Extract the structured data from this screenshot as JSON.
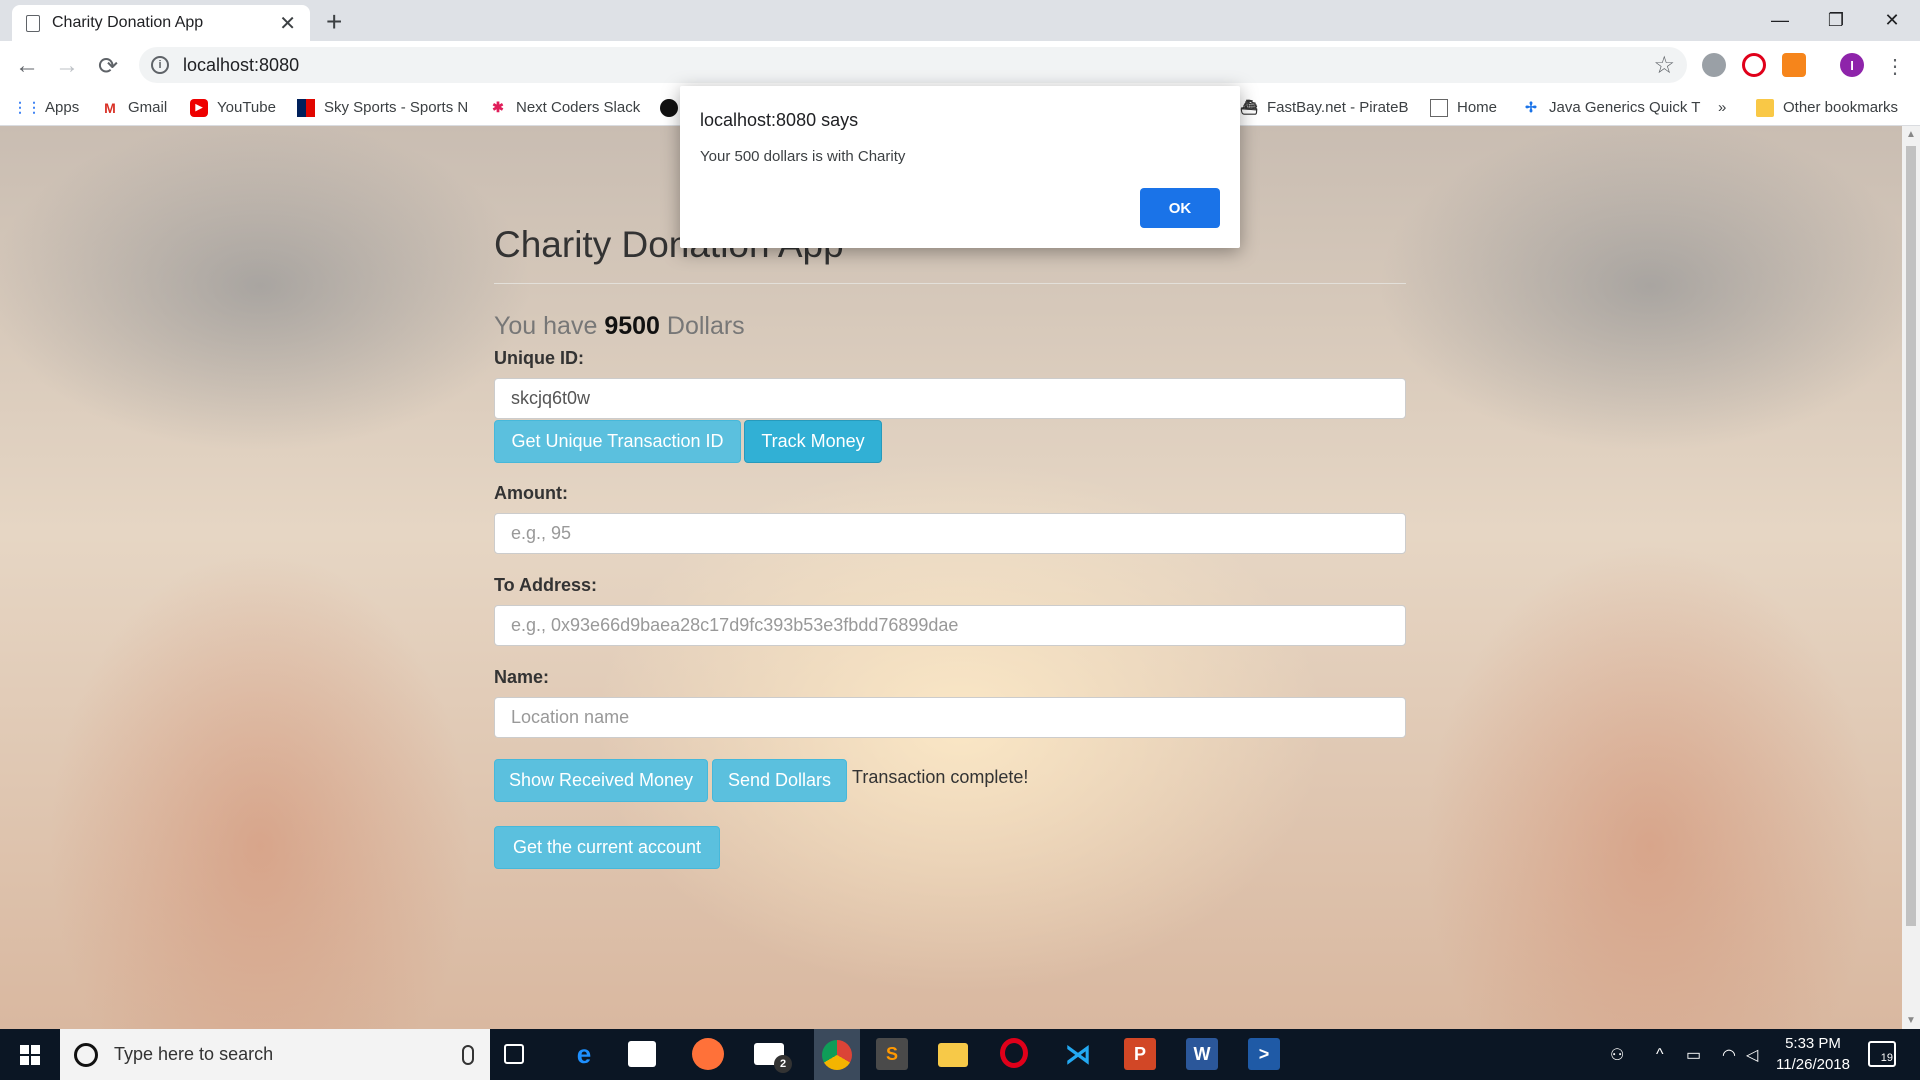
{
  "browser": {
    "tab_title": "Charity Donation App",
    "url": "localhost:8080",
    "profile_initial": "I",
    "bookmarks": [
      {
        "label": "Apps",
        "icon": "apps-grid-icon"
      },
      {
        "label": "Gmail",
        "icon": "gmail-icon"
      },
      {
        "label": "YouTube",
        "icon": "youtube-icon"
      },
      {
        "label": "Sky Sports - Sports N",
        "icon": "sky-sports-icon"
      },
      {
        "label": "Next Coders Slack",
        "icon": "slack-icon"
      },
      {
        "label": "",
        "icon": "github-icon"
      },
      {
        "label": "FastBay.net - PirateB",
        "icon": "ship-icon"
      },
      {
        "label": "Home",
        "icon": "page-icon"
      },
      {
        "label": "Java Generics Quick T",
        "icon": "java-icon"
      }
    ],
    "overflow_label": "»",
    "other_bookmarks": "Other bookmarks"
  },
  "app": {
    "title": "Charity Donation App",
    "balance_prefix": "You have",
    "balance_value": "9500",
    "balance_suffix": "Dollars",
    "unique_id_label": "Unique ID:",
    "unique_id_value": "skcjq6t0w",
    "get_id_button": "Get Unique Transaction ID",
    "track_button": "Track Money",
    "amount_label": "Amount:",
    "amount_placeholder": "e.g., 95",
    "address_label": "To Address:",
    "address_placeholder": "e.g., 0x93e66d9baea28c17d9fc393b53e3fbdd76899dae",
    "name_label": "Name:",
    "name_placeholder": "Location name",
    "show_received_button": "Show Received Money",
    "send_button": "Send Dollars",
    "status_text": "Transaction complete!",
    "current_account_button": "Get the current account"
  },
  "dialog": {
    "title": "localhost:8080 says",
    "message": "Your 500 dollars is with Charity",
    "ok_label": "OK"
  },
  "taskbar": {
    "search_placeholder": "Type here to search",
    "mail_badge": "2",
    "time": "5:33 PM",
    "date": "11/26/2018",
    "notification_count": "19"
  }
}
